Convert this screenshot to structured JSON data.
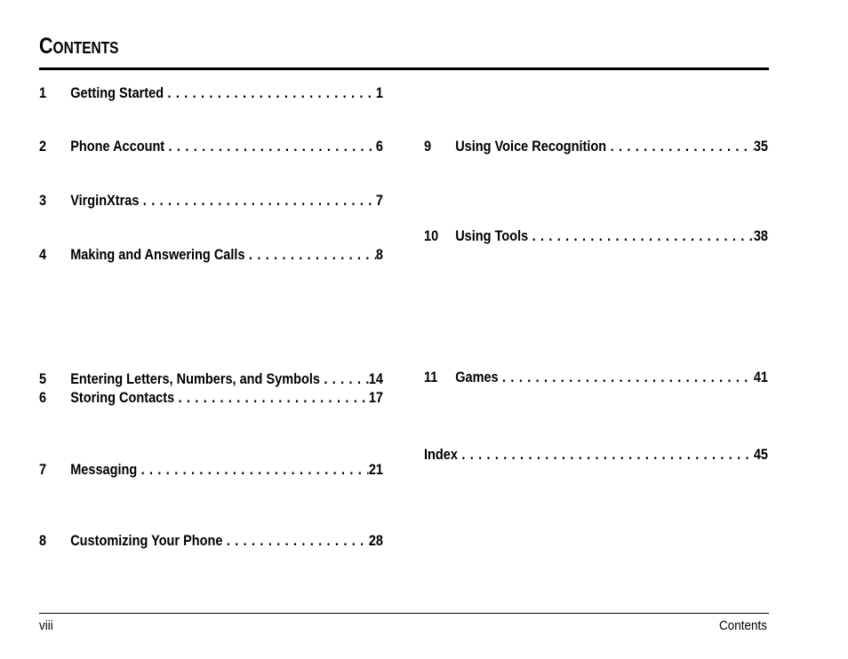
{
  "header": {
    "title": "Contents"
  },
  "toc": {
    "left": [
      {
        "number": "1",
        "label": "Getting Started",
        "page": "1"
      },
      {
        "number": "2",
        "label": "Phone Account",
        "page": "6"
      },
      {
        "number": "3",
        "label": "VirginXtras",
        "page": "7"
      },
      {
        "number": "4",
        "label": "Making and Answering Calls",
        "page": "8"
      },
      {
        "number": "5",
        "label": "Entering Letters, Numbers, and Symbols",
        "page": "14"
      },
      {
        "number": "6",
        "label": "Storing Contacts",
        "page": "17"
      },
      {
        "number": "7",
        "label": "Messaging",
        "page": "21"
      },
      {
        "number": "8",
        "label": "Customizing Your Phone",
        "page": "28"
      }
    ],
    "right": [
      {
        "number": "9",
        "label": "Using Voice Recognition",
        "page": "35"
      },
      {
        "number": "10",
        "label": "Using Tools",
        "page": "38"
      },
      {
        "number": "11",
        "label": "Games",
        "page": "41"
      },
      {
        "number": "",
        "label": "Index",
        "page": "45"
      }
    ]
  },
  "footer": {
    "page_number": "viii",
    "section": "Contents"
  }
}
